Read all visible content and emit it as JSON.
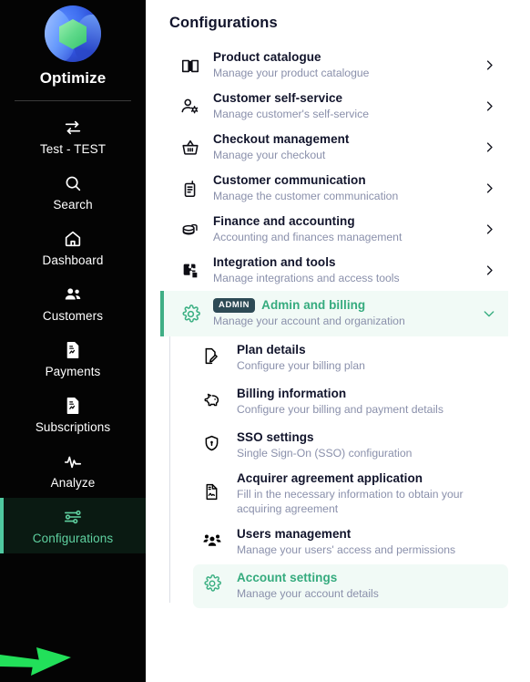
{
  "sidebar": {
    "brand": {
      "name": "Optimize",
      "logo_icon": "optimize-logo"
    },
    "items": [
      {
        "label": "Test - TEST",
        "icon": "swap-icon",
        "active": false
      },
      {
        "label": "Search",
        "icon": "search-icon",
        "active": false
      },
      {
        "label": "Dashboard",
        "icon": "home-icon",
        "active": false
      },
      {
        "label": "Customers",
        "icon": "people-icon",
        "active": false
      },
      {
        "label": "Payments",
        "icon": "document-chart-icon",
        "active": false
      },
      {
        "label": "Subscriptions",
        "icon": "document-repeat-icon",
        "active": false
      },
      {
        "label": "Analyze",
        "icon": "pulse-icon",
        "active": false
      },
      {
        "label": "Configurations",
        "icon": "sliders-icon",
        "active": true
      }
    ],
    "accent_active": "#4fc9a0",
    "background": "#040404"
  },
  "main": {
    "page_title": "Configurations",
    "rows": [
      {
        "title": "Product catalogue",
        "subtitle": "Manage your product catalogue",
        "icon": "book-icon",
        "chevron": "chevron-right-icon"
      },
      {
        "title": "Customer self-service",
        "subtitle": "Manage customer's self-service",
        "icon": "person-gear-icon",
        "chevron": "chevron-right-icon"
      },
      {
        "title": "Checkout management",
        "subtitle": "Manage your checkout",
        "icon": "basket-icon",
        "chevron": "chevron-right-icon"
      },
      {
        "title": "Customer communication",
        "subtitle": "Manage the customer communication",
        "icon": "radio-icon",
        "chevron": "chevron-right-icon"
      },
      {
        "title": "Finance and accounting",
        "subtitle": "Accounting and finances management",
        "icon": "coins-icon",
        "chevron": "chevron-right-icon"
      },
      {
        "title": "Integration and tools",
        "subtitle": "Manage integrations and access tools",
        "icon": "puzzle-icon",
        "chevron": "chevron-right-icon"
      }
    ],
    "expanded_row": {
      "badge": "ADMIN",
      "title": "Admin and billing",
      "subtitle": "Manage your account and organization",
      "icon": "gear-icon",
      "chevron": "chevron-down-icon",
      "accent": "#35ab7e",
      "background": "#f1faf6"
    },
    "sub_rows": [
      {
        "title": "Plan details",
        "subtitle": "Configure your billing plan",
        "icon": "file-pen-icon",
        "selected": false
      },
      {
        "title": "Billing information",
        "subtitle": "Configure your billing and payment details",
        "icon": "piggy-bank-icon",
        "selected": false
      },
      {
        "title": "SSO settings",
        "subtitle": "Single Sign-On (SSO) configuration",
        "icon": "shield-lock-icon",
        "selected": false
      },
      {
        "title": "Acquirer agreement application",
        "subtitle": "Fill in the necessary information to obtain your acquiring agreement",
        "icon": "document-signature-icon",
        "selected": false
      },
      {
        "title": "Users management",
        "subtitle": "Manage your users' access and permissions",
        "icon": "users-group-icon",
        "selected": false
      },
      {
        "title": "Account settings",
        "subtitle": "Manage your account details",
        "icon": "gear-icon",
        "selected": true
      }
    ]
  },
  "annotation": {
    "arrow_icon": "green-arrow-right",
    "color": "#22e05a"
  }
}
